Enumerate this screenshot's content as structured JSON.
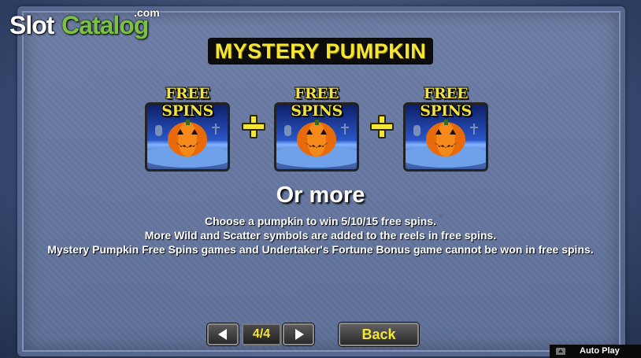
{
  "logo": {
    "slot": "Slot",
    "catalog": "Catalog",
    "com": ".com"
  },
  "title": "MYSTERY PUMPKIN",
  "symbols": [
    {
      "label": "FREE SPINS",
      "icon": "pumpkin-icon"
    },
    {
      "label": "FREE SPINS",
      "icon": "pumpkin-icon"
    },
    {
      "label": "FREE SPINS",
      "icon": "pumpkin-icon"
    }
  ],
  "or_more": "Or more",
  "description": [
    "Choose a pumpkin to win 5/10/15 free spins.",
    "More Wild and Scatter symbols are added to the reels in free spins.",
    "Mystery Pumpkin Free Spins games and Undertaker's Fortune Bonus game cannot be won in free spins."
  ],
  "nav": {
    "prev_icon": "arrow-left-icon",
    "next_icon": "arrow-right-icon",
    "page": "4/4",
    "back_label": "Back"
  },
  "autoplay": {
    "label": "Auto Play",
    "icon": "chevron-up-icon"
  },
  "colors": {
    "title_text": "#f5e634",
    "logo_green": "#7cc242",
    "panel": "#6879a2"
  }
}
